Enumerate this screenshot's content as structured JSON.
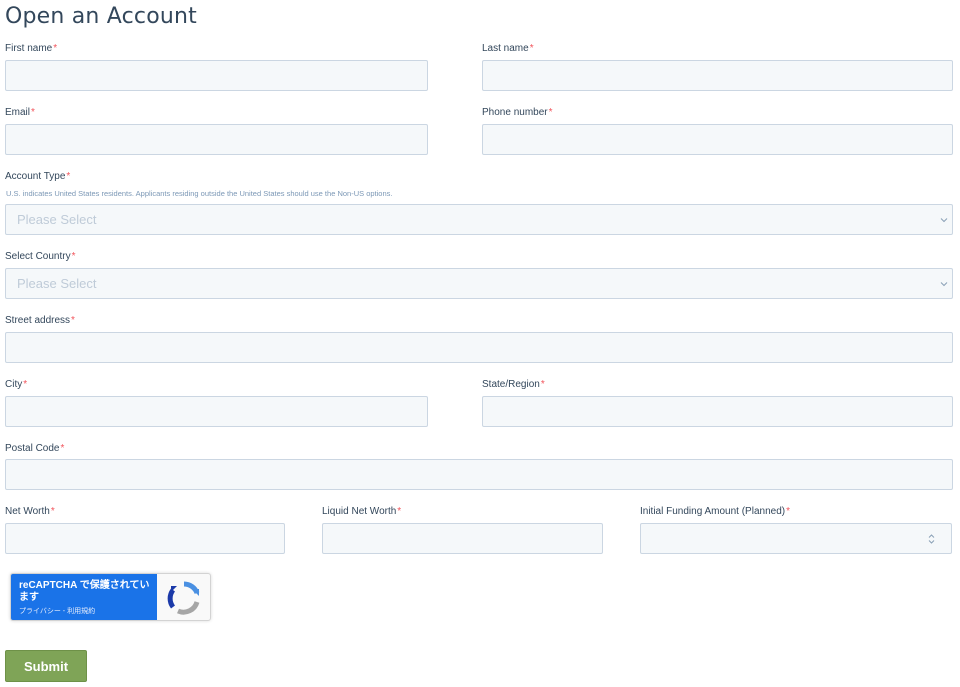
{
  "page": {
    "title": "Open an Account"
  },
  "form": {
    "required_marker": "*",
    "first_name": {
      "label": "First name",
      "value": ""
    },
    "last_name": {
      "label": "Last name",
      "value": ""
    },
    "email": {
      "label": "Email",
      "value": ""
    },
    "phone": {
      "label": "Phone number",
      "value": ""
    },
    "account_type": {
      "label": "Account Type",
      "help": "U.S. indicates United States residents. Applicants residing outside the United States should use the Non-US options.",
      "placeholder": "Please Select"
    },
    "country": {
      "label": "Select Country",
      "placeholder": "Please Select"
    },
    "street": {
      "label": "Street address",
      "value": ""
    },
    "city": {
      "label": "City",
      "value": ""
    },
    "state": {
      "label": "State/Region",
      "value": ""
    },
    "postal": {
      "label": "Postal Code",
      "value": ""
    },
    "net_worth": {
      "label": "Net Worth",
      "value": ""
    },
    "liquid_net_worth": {
      "label": "Liquid Net Worth",
      "value": ""
    },
    "initial_funding": {
      "label": "Initial Funding Amount (Planned)",
      "value": ""
    }
  },
  "recaptcha": {
    "title": "reCAPTCHA で保護されています",
    "links": "プライバシー - 利用規約"
  },
  "submit": {
    "label": "Submit"
  },
  "icons": {
    "select_arrow": "chevron-down-icon",
    "number_spinner": "spinner-icon",
    "recaptcha_logo": "recaptcha-logo-icon"
  },
  "colors": {
    "required": "#f2545b",
    "submit_bg": "#7fa457",
    "input_bg": "#f5f8fa",
    "input_border": "#cbd6e2",
    "recaptcha_blue": "#1a73e8"
  }
}
